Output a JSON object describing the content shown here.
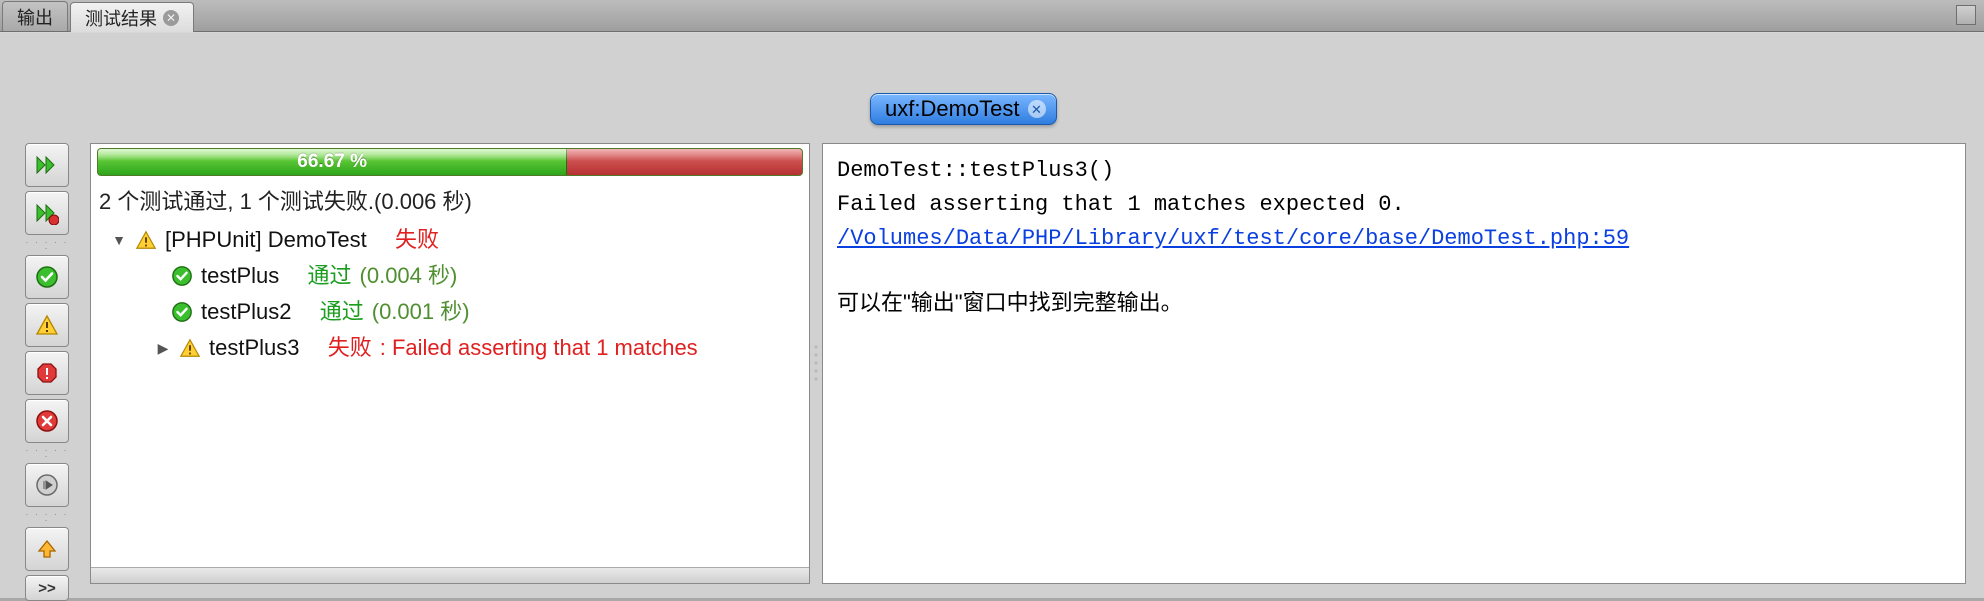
{
  "tabs": {
    "output": "输出",
    "results": "测试结果"
  },
  "inner_tab": "uxf:DemoTest",
  "progress": {
    "percent": 66.67,
    "label": "66.67 %"
  },
  "summary": "2 个测试通过, 1 个测试失败.(0.006 秒)",
  "tree": {
    "suite": {
      "name": "[PHPUnit] DemoTest",
      "status": "失败"
    },
    "tests": [
      {
        "name": "testPlus",
        "status": "通过",
        "time": "(0.004 秒)",
        "pass": true
      },
      {
        "name": "testPlus2",
        "status": "通过",
        "time": "(0.001 秒)",
        "pass": true
      },
      {
        "name": "testPlus3",
        "status": "失败",
        "time": "",
        "pass": false,
        "fail_detail": ": Failed asserting that 1 matches"
      }
    ]
  },
  "detail": {
    "line1": "DemoTest::testPlus3()",
    "line2": "Failed asserting that 1 matches expected 0.",
    "link": "/Volumes/Data/PHP/Library/uxf/test/core/base/DemoTest.php:59",
    "note": "可以在\"输出\"窗口中找到完整输出。"
  }
}
